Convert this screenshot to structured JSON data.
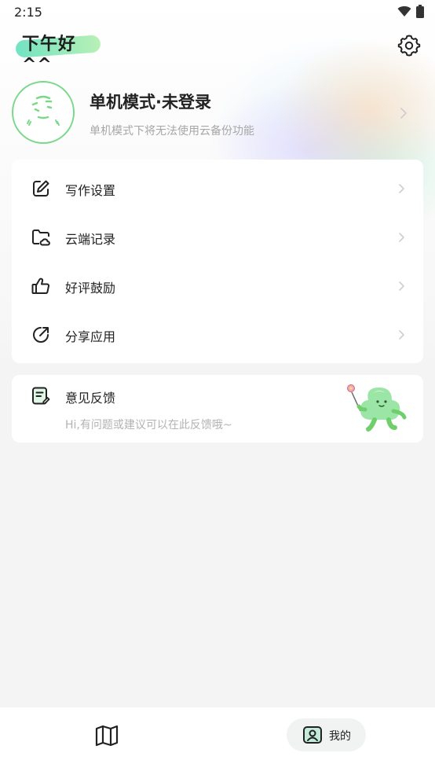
{
  "status": {
    "time": "2:15"
  },
  "header": {
    "greeting": "下午好 ^^"
  },
  "profile": {
    "name": "单机模式·未登录",
    "subtitle": "单机模式下将无法使用云备份功能"
  },
  "menu": {
    "items": [
      {
        "label": "写作设置",
        "icon": "edit-icon"
      },
      {
        "label": "云端记录",
        "icon": "cloud-folder-icon"
      },
      {
        "label": "好评鼓励",
        "icon": "thumbs-up-icon"
      },
      {
        "label": "分享应用",
        "icon": "share-icon"
      }
    ]
  },
  "feedback": {
    "title": "意见反馈",
    "subtitle": "Hi,有问题或建议可以在此反馈哦~"
  },
  "nav": {
    "items": [
      {
        "label": "",
        "icon": "map-icon"
      },
      {
        "label": "我的",
        "icon": "profile-badge-icon"
      }
    ]
  },
  "colors": {
    "accent": "#7bd88b",
    "chevron": "#cfcfcf"
  }
}
